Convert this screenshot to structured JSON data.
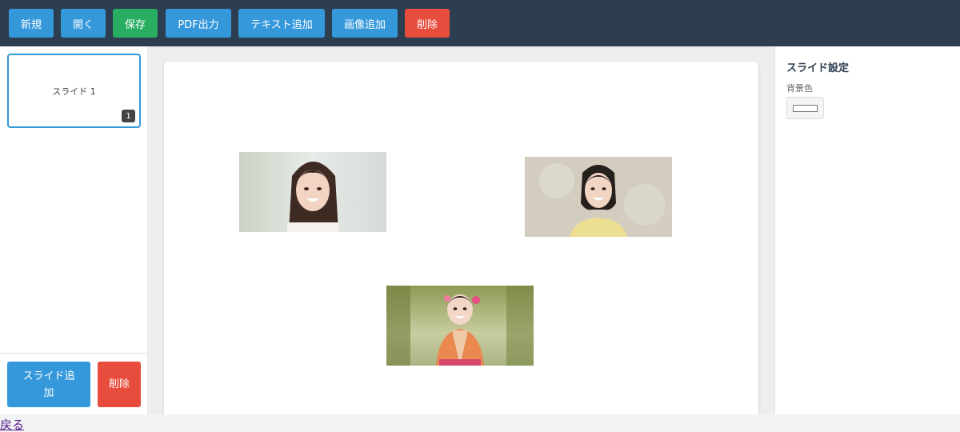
{
  "toolbar": {
    "new_label": "新規",
    "open_label": "開く",
    "save_label": "保存",
    "pdf_label": "PDF出力",
    "add_text_label": "テキスト追加",
    "add_image_label": "画像追加",
    "delete_label": "削除"
  },
  "sidebar": {
    "slides": [
      {
        "label": "スライド 1",
        "number": "1"
      }
    ],
    "add_slide_label": "スライド追加",
    "delete_slide_label": "削除"
  },
  "properties": {
    "title": "スライド設定",
    "background_label": "背景色",
    "background_color": "#ffffff"
  },
  "footer": {
    "back_label": "戻る"
  },
  "colors": {
    "toolbar_bg": "#2c3e50",
    "primary": "#3498db",
    "success": "#27ae60",
    "danger": "#e74c3c"
  },
  "slide_images": [
    {
      "name": "portrait-woman-long-hair"
    },
    {
      "name": "portrait-woman-bob-yellow-top"
    },
    {
      "name": "portrait-woman-kimono"
    }
  ]
}
